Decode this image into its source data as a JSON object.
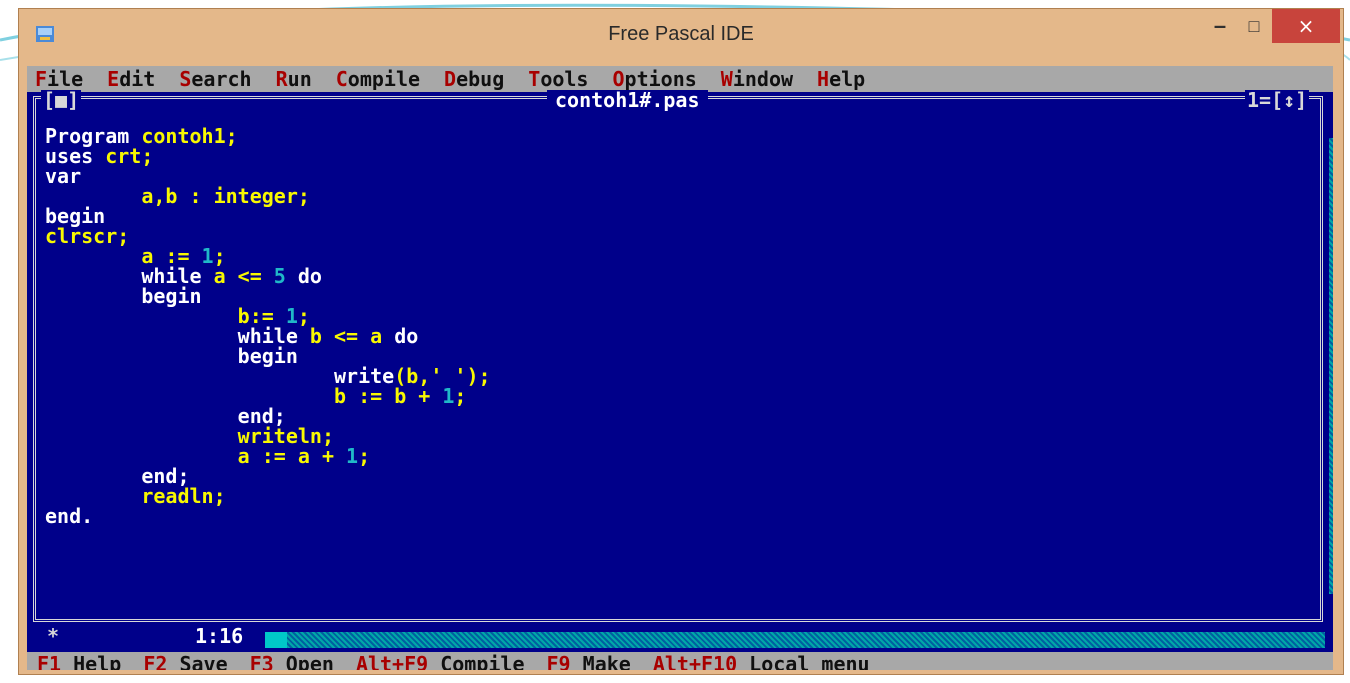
{
  "window": {
    "title": "Free Pascal IDE",
    "minimize_glyph": "–",
    "maximize_glyph": "□",
    "close_glyph": "×"
  },
  "menu": [
    {
      "label": "File"
    },
    {
      "label": "Edit"
    },
    {
      "label": "Search"
    },
    {
      "label": "Run"
    },
    {
      "label": "Compile"
    },
    {
      "label": "Debug"
    },
    {
      "label": "Tools"
    },
    {
      "label": "Options"
    },
    {
      "label": "Window"
    },
    {
      "label": "Help"
    }
  ],
  "editor": {
    "filename": "contoh1#.pas",
    "close_box": "[■]",
    "window_number": "1=[↕]",
    "cursor_position": "1:16",
    "modified_marker": "*",
    "code": [
      {
        "indent": "",
        "tokens": [
          {
            "t": "Program ",
            "c": "w"
          },
          {
            "t": "contoh1;",
            "c": "y"
          }
        ]
      },
      {
        "indent": "",
        "tokens": [
          {
            "t": "uses ",
            "c": "w"
          },
          {
            "t": "crt;",
            "c": "y"
          }
        ]
      },
      {
        "indent": "",
        "tokens": [
          {
            "t": "var",
            "c": "w"
          }
        ]
      },
      {
        "indent": "        ",
        "tokens": [
          {
            "t": "a,b : integer;",
            "c": "y"
          }
        ]
      },
      {
        "indent": "",
        "tokens": [
          {
            "t": "begin",
            "c": "w"
          }
        ]
      },
      {
        "indent": "",
        "tokens": [
          {
            "t": "clrscr;",
            "c": "y"
          }
        ]
      },
      {
        "indent": "        ",
        "tokens": [
          {
            "t": "a := ",
            "c": "y"
          },
          {
            "t": "1",
            "c": "c"
          },
          {
            "t": ";",
            "c": "y"
          }
        ]
      },
      {
        "indent": "        ",
        "tokens": [
          {
            "t": "while ",
            "c": "w"
          },
          {
            "t": "a <= ",
            "c": "y"
          },
          {
            "t": "5",
            "c": "c"
          },
          {
            "t": " do",
            "c": "w"
          }
        ]
      },
      {
        "indent": "        ",
        "tokens": [
          {
            "t": "begin",
            "c": "w"
          }
        ]
      },
      {
        "indent": "                ",
        "tokens": [
          {
            "t": "b:= ",
            "c": "y"
          },
          {
            "t": "1",
            "c": "c"
          },
          {
            "t": ";",
            "c": "y"
          }
        ]
      },
      {
        "indent": "                ",
        "tokens": [
          {
            "t": "while ",
            "c": "w"
          },
          {
            "t": "b <= a",
            "c": "y"
          },
          {
            "t": " do",
            "c": "w"
          }
        ]
      },
      {
        "indent": "                ",
        "tokens": [
          {
            "t": "begin",
            "c": "w"
          }
        ]
      },
      {
        "indent": "                        ",
        "tokens": [
          {
            "t": "write",
            "c": "w"
          },
          {
            "t": "(b,' ');",
            "c": "y"
          }
        ]
      },
      {
        "indent": "                        ",
        "tokens": [
          {
            "t": "b := b + ",
            "c": "y"
          },
          {
            "t": "1",
            "c": "c"
          },
          {
            "t": ";",
            "c": "y"
          }
        ]
      },
      {
        "indent": "                ",
        "tokens": [
          {
            "t": "end;",
            "c": "w"
          }
        ]
      },
      {
        "indent": "                ",
        "tokens": [
          {
            "t": "writeln;",
            "c": "y"
          }
        ]
      },
      {
        "indent": "                ",
        "tokens": [
          {
            "t": "a := a + ",
            "c": "y"
          },
          {
            "t": "1",
            "c": "c"
          },
          {
            "t": ";",
            "c": "y"
          }
        ]
      },
      {
        "indent": "        ",
        "tokens": [
          {
            "t": "end;",
            "c": "w"
          }
        ]
      },
      {
        "indent": "        ",
        "tokens": [
          {
            "t": "readln;",
            "c": "y"
          }
        ]
      },
      {
        "indent": "",
        "tokens": [
          {
            "t": "end.",
            "c": "w"
          }
        ]
      }
    ]
  },
  "statusbar": [
    {
      "key": "F1",
      "label": "Help"
    },
    {
      "key": "F2",
      "label": "Save"
    },
    {
      "key": "F3",
      "label": "Open"
    },
    {
      "key": "Alt+F9",
      "label": "Compile"
    },
    {
      "key": "F9",
      "label": "Make"
    },
    {
      "key": "Alt+F10",
      "label": "Local menu"
    }
  ],
  "colors": {
    "background": "#00008a",
    "menubar": "#a8a8a8",
    "hotkey": "#a80000",
    "keyword": "#ffffff",
    "identifier": "#f8f800",
    "number": "#20b8c8",
    "window_frame": "#e4b88a",
    "close_button": "#c8443c"
  }
}
